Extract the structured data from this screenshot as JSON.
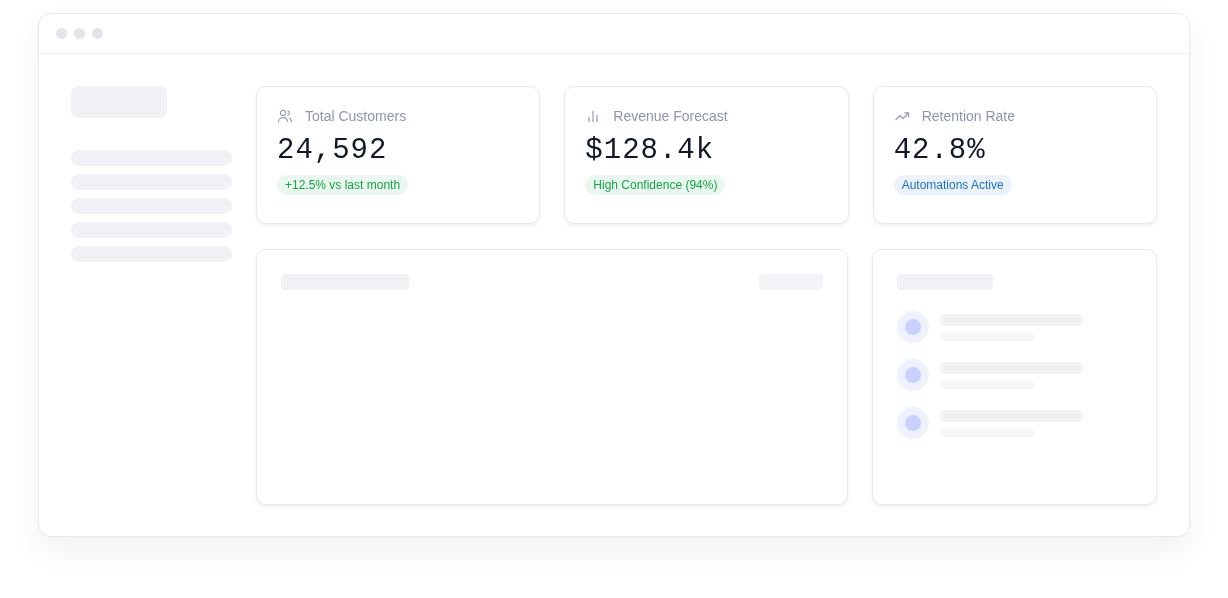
{
  "metrics": [
    {
      "kind": "users",
      "label": "Total Customers",
      "value": "24,592",
      "badge": {
        "text": "+12.5% vs last month",
        "color": "#16a34a"
      }
    },
    {
      "kind": "bars",
      "label": "Revenue Forecast",
      "value": "$128.4k",
      "badge": {
        "text": "High Confidence (94%)",
        "color": "#16a34a"
      }
    },
    {
      "kind": "trend",
      "label": "Retention Rate",
      "value": "42.8%",
      "badge": {
        "text": "Automations Active",
        "color": "#1d74c9"
      }
    }
  ]
}
